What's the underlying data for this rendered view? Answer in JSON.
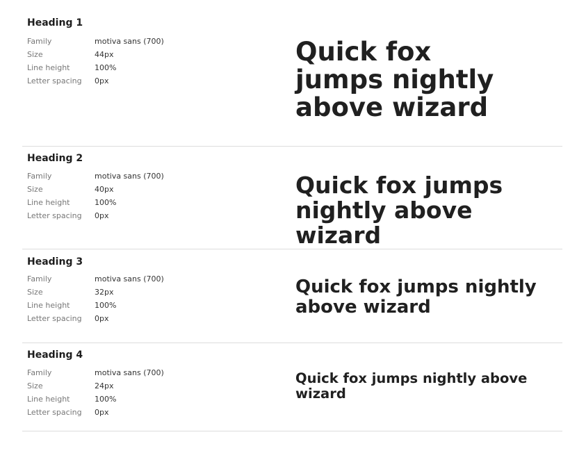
{
  "styles": [
    {
      "name": "Heading 1",
      "specs": [
        {
          "label": "Family",
          "value": "motiva sans (700)"
        },
        {
          "label": "Size",
          "value": "44px"
        },
        {
          "label": "Line height",
          "value": "100%"
        },
        {
          "label": "Letter spacing",
          "value": "0px"
        }
      ],
      "sample": "Quick fox jumps nightly above wizard"
    },
    {
      "name": "Heading 2",
      "specs": [
        {
          "label": "Family",
          "value": "motiva sans (700)"
        },
        {
          "label": "Size",
          "value": "40px"
        },
        {
          "label": "Line height",
          "value": "100%"
        },
        {
          "label": "Letter spacing",
          "value": "0px"
        }
      ],
      "sample": "Quick fox jumps nightly above wizard"
    },
    {
      "name": "Heading 3",
      "specs": [
        {
          "label": "Family",
          "value": "motiva sans (700)"
        },
        {
          "label": "Size",
          "value": "32px"
        },
        {
          "label": "Line height",
          "value": "100%"
        },
        {
          "label": "Letter spacing",
          "value": "0px"
        }
      ],
      "sample": "Quick fox jumps nightly above wizard"
    },
    {
      "name": "Heading 4",
      "specs": [
        {
          "label": "Family",
          "value": "motiva sans (700)"
        },
        {
          "label": "Size",
          "value": "24px"
        },
        {
          "label": "Line height",
          "value": "100%"
        },
        {
          "label": "Letter spacing",
          "value": "0px"
        }
      ],
      "sample": "Quick fox jumps nightly above wizard"
    }
  ]
}
